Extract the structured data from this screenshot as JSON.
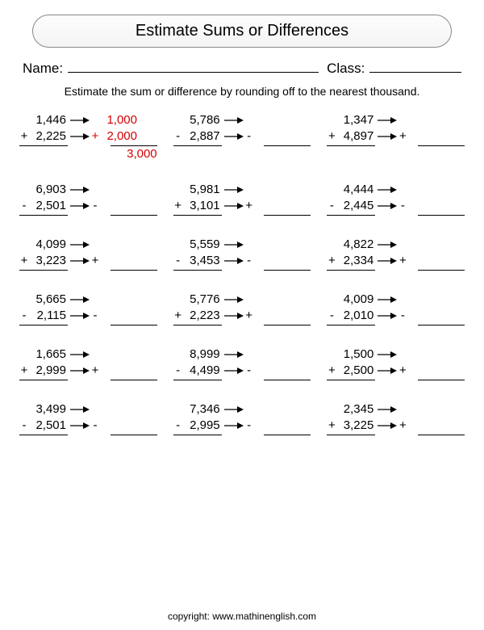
{
  "title": "Estimate Sums or Differences",
  "labels": {
    "name": "Name:",
    "class": "Class:"
  },
  "instruction": "Estimate the sum or difference by rounding off to the nearest thousand.",
  "footer": "copyright:   www.mathinenglish.com",
  "problems": [
    {
      "a": "1,446",
      "op": "+",
      "b": "2,225",
      "example": true,
      "ra": "1,000",
      "rb": "2,000",
      "ans": "3,000"
    },
    {
      "a": "5,786",
      "op": "-",
      "b": "2,887"
    },
    {
      "a": "1,347",
      "op": "+",
      "b": "4,897"
    },
    {
      "a": "6,903",
      "op": "-",
      "b": "2,501"
    },
    {
      "a": "5,981",
      "op": "+",
      "b": "3,101"
    },
    {
      "a": "4,444",
      "op": "-",
      "b": "2,445"
    },
    {
      "a": "4,099",
      "op": "+",
      "b": "3,223"
    },
    {
      "a": "5,559",
      "op": "-",
      "b": "3,453"
    },
    {
      "a": "4,822",
      "op": "+",
      "b": "2,334"
    },
    {
      "a": "5,665",
      "op": "-",
      "b": "2,115"
    },
    {
      "a": "5,776",
      "op": "+",
      "b": "2,223"
    },
    {
      "a": "4,009",
      "op": "-",
      "b": "2,010"
    },
    {
      "a": "1,665",
      "op": "+",
      "b": "2,999"
    },
    {
      "a": "8,999",
      "op": "-",
      "b": "4,499"
    },
    {
      "a": "1,500",
      "op": "+",
      "b": "2,500"
    },
    {
      "a": "3,499",
      "op": "-",
      "b": "2,501"
    },
    {
      "a": "7,346",
      "op": "-",
      "b": "2,995"
    },
    {
      "a": "2,345",
      "op": "+",
      "b": "3,225"
    }
  ]
}
